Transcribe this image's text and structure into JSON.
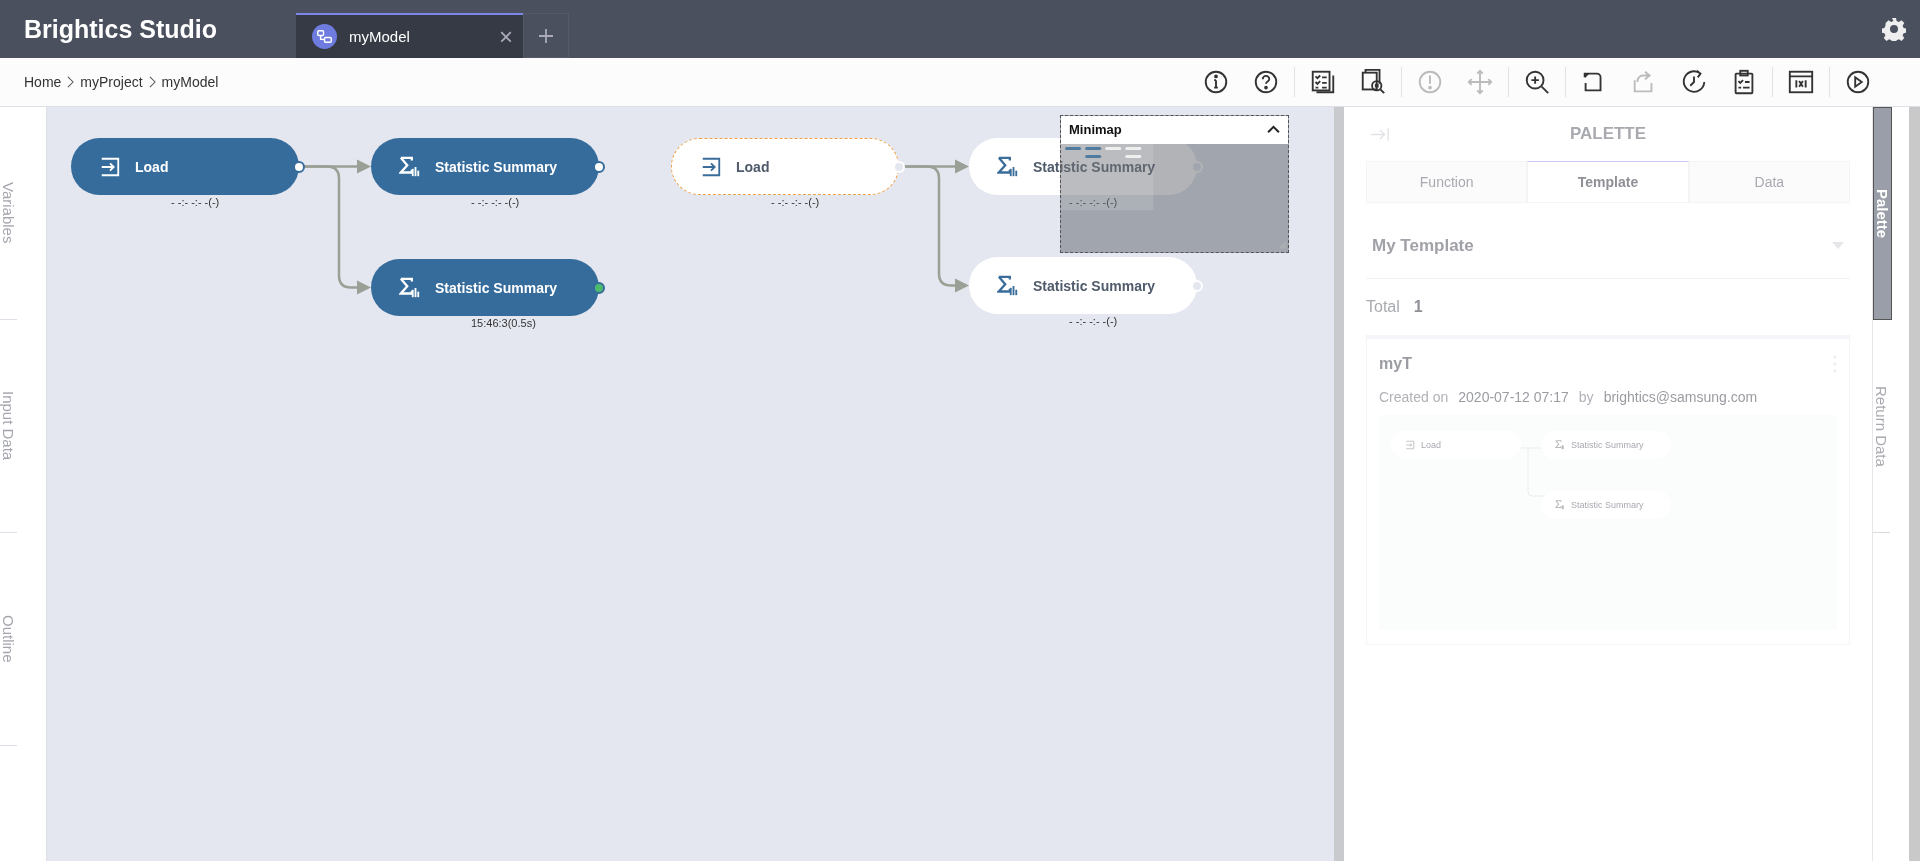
{
  "app": {
    "title": "Brightics Studio"
  },
  "tabs": [
    {
      "label": "myModel",
      "selected": true,
      "close": "×"
    }
  ],
  "breadcrumb": [
    "Home",
    "myProject",
    "myModel"
  ],
  "toolbar": [
    [
      {
        "kind": "info",
        "disabled": false
      },
      {
        "kind": "help",
        "disabled": false
      }
    ],
    [
      {
        "kind": "checklist",
        "disabled": false
      },
      {
        "kind": "inspect",
        "disabled": false
      }
    ],
    [
      {
        "kind": "warning",
        "disabled": true
      },
      {
        "kind": "move",
        "disabled": true
      }
    ],
    [
      {
        "kind": "zoom",
        "disabled": false
      }
    ],
    [
      {
        "kind": "undo",
        "disabled": false
      },
      {
        "kind": "redo",
        "disabled": true
      },
      {
        "kind": "history",
        "disabled": false
      },
      {
        "kind": "clipboard",
        "disabled": false
      }
    ],
    [
      {
        "kind": "variable",
        "disabled": false
      }
    ],
    [
      {
        "kind": "run",
        "disabled": false
      }
    ]
  ],
  "left_tabs": [
    {
      "label": "Variables",
      "selected": false
    },
    {
      "label": "Input Data",
      "selected": false
    },
    {
      "label": "Outline",
      "selected": false
    }
  ],
  "nodes": [
    {
      "kind": "load",
      "label": "Load",
      "filled": true,
      "selected": false,
      "done": false,
      "status": "- -:- -:- -(-)"
    },
    {
      "kind": "statistic",
      "label": "Statistic Summary",
      "filled": true,
      "selected": false,
      "done": false,
      "status": "- -:- -:- -(-)"
    },
    {
      "kind": "statistic",
      "label": "Statistic Summary",
      "filled": true,
      "selected": false,
      "done": true,
      "status": "15:46:3(0.5s)"
    },
    {
      "kind": "load",
      "label": "Load",
      "filled": false,
      "selected": true,
      "done": false,
      "status": "- -:- -:- -(-)"
    },
    {
      "kind": "statistic",
      "label": "Statistic Summary",
      "filled": false,
      "selected": false,
      "done": false,
      "status": "- -:- -:- -(-)"
    },
    {
      "kind": "statistic",
      "label": "Statistic Summary",
      "filled": false,
      "selected": false,
      "done": false,
      "status": "- -:- -:- -(-)"
    }
  ],
  "minimap": {
    "title": "Minimap",
    "expanded": true
  },
  "palette": {
    "title": "PALETTE",
    "tabs": [
      {
        "label": "Function",
        "selected": false
      },
      {
        "label": "Template",
        "selected": true
      },
      {
        "label": "Data",
        "selected": false
      }
    ],
    "dropdown": {
      "value": "My Template"
    },
    "total_label": "Total",
    "total": "1",
    "templates": [
      {
        "name": "myT",
        "created_label": "Created on",
        "created": "2020-07-12 07:17",
        "by_label": "by",
        "author": "brightics@samsung.com",
        "preview": [
          {
            "kind": "load",
            "label": "Load"
          },
          {
            "kind": "statistic",
            "label": "Statistic Summary"
          },
          {
            "kind": "statistic",
            "label": "Statistic Summary"
          }
        ]
      }
    ]
  },
  "right_tabs": [
    {
      "label": "Palette",
      "selected": true
    },
    {
      "label": "Return Data",
      "selected": false
    }
  ]
}
